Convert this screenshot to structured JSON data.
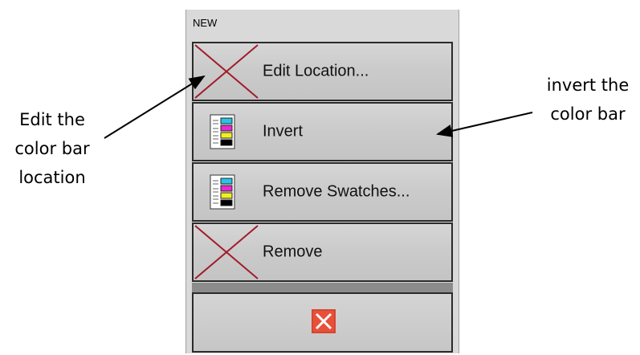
{
  "panel": {
    "title": "NEW"
  },
  "menu": {
    "items": [
      {
        "label": "Edit Location...",
        "icon": "red-x-icon"
      },
      {
        "label": "Invert",
        "icon": "color-bar-icon"
      },
      {
        "label": "Remove Swatches...",
        "icon": "color-bar-icon"
      },
      {
        "label": "Remove",
        "icon": "red-x-icon"
      }
    ],
    "close_icon": "close-icon"
  },
  "annotations": {
    "left_line1": "Edit the",
    "left_line2": "color bar",
    "left_line3": "location",
    "right_line1": "invert the",
    "right_line2": "color bar"
  },
  "colors": {
    "x_stroke": "#a11c2a",
    "close_bg": "#e8503a"
  }
}
